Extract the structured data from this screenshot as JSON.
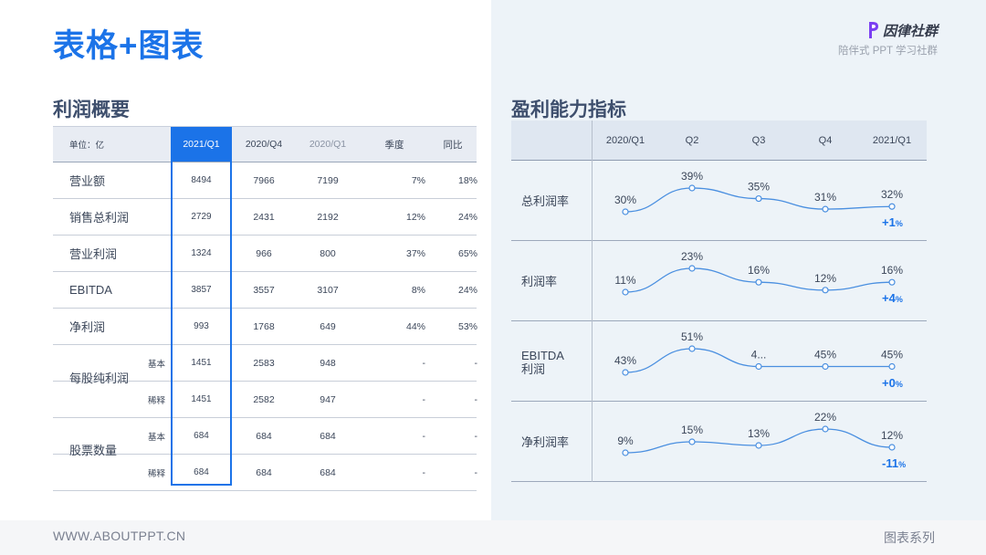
{
  "header": {
    "title": "表格+图表",
    "logo_text": "因律社群",
    "slogan": "陪伴式 PPT 学习社群"
  },
  "left": {
    "section_title": "利润概要",
    "unit_label": "单位：亿",
    "columns": [
      "2021/Q1",
      "2020/Q4",
      "2020/Q1",
      "季度",
      "同比"
    ],
    "rows": [
      {
        "label": "营业额",
        "sub": "",
        "values": [
          "8494",
          "7966",
          "7199",
          "7%",
          "18%"
        ]
      },
      {
        "label": "销售总利润",
        "sub": "",
        "values": [
          "2729",
          "2431",
          "2192",
          "12%",
          "24%"
        ]
      },
      {
        "label": "营业利润",
        "sub": "",
        "values": [
          "1324",
          "966",
          "800",
          "37%",
          "65%"
        ]
      },
      {
        "label": "EBITDA",
        "sub": "",
        "values": [
          "3857",
          "3557",
          "3107",
          "8%",
          "24%"
        ]
      },
      {
        "label": "净利润",
        "sub": "",
        "values": [
          "993",
          "1768",
          "649",
          "44%",
          "53%"
        ]
      },
      {
        "label": "",
        "sub": "基本",
        "values": [
          "1451",
          "2583",
          "948",
          "-",
          "-"
        ]
      },
      {
        "label": "",
        "sub": "稀释",
        "values": [
          "1451",
          "2582",
          "947",
          "-",
          "-"
        ]
      },
      {
        "label": "",
        "sub": "基本",
        "values": [
          "684",
          "684",
          "684",
          "-",
          "-"
        ]
      },
      {
        "label": "",
        "sub": "稀释",
        "values": [
          "684",
          "684",
          "684",
          "-",
          "-"
        ]
      }
    ],
    "group_labels": [
      "每股纯利润",
      "股票数量"
    ]
  },
  "right": {
    "section_title": "盈利能力指标",
    "columns": [
      "2020/Q1",
      "Q2",
      "Q3",
      "Q4",
      "2021/Q1"
    ],
    "metrics": [
      {
        "label": "总利润率",
        "values": [
          30,
          39,
          35,
          31,
          32
        ],
        "labels": [
          "30%",
          "39%",
          "35%",
          "31%",
          "32%"
        ],
        "change": "+1",
        "unit": "%"
      },
      {
        "label": "利润率",
        "values": [
          11,
          23,
          16,
          12,
          16
        ],
        "labels": [
          "11%",
          "23%",
          "16%",
          "12%",
          "16%"
        ],
        "change": "+4",
        "unit": "%"
      },
      {
        "label": "EBITDA\n利润",
        "values": [
          43,
          51,
          45,
          45,
          45
        ],
        "labels": [
          "43%",
          "51%",
          "4...",
          "45%",
          "45%"
        ],
        "change": "+0",
        "unit": "%"
      },
      {
        "label": "净利润率",
        "values": [
          9,
          15,
          13,
          22,
          12
        ],
        "labels": [
          "9%",
          "15%",
          "13%",
          "22%",
          "12%"
        ],
        "change": "-11",
        "unit": "%"
      }
    ],
    "accent": "#1b73e8",
    "line_color": "#4a8fe0"
  },
  "footer": {
    "url": "WWW.ABOUTPPT.CN",
    "series": "图表系列"
  }
}
